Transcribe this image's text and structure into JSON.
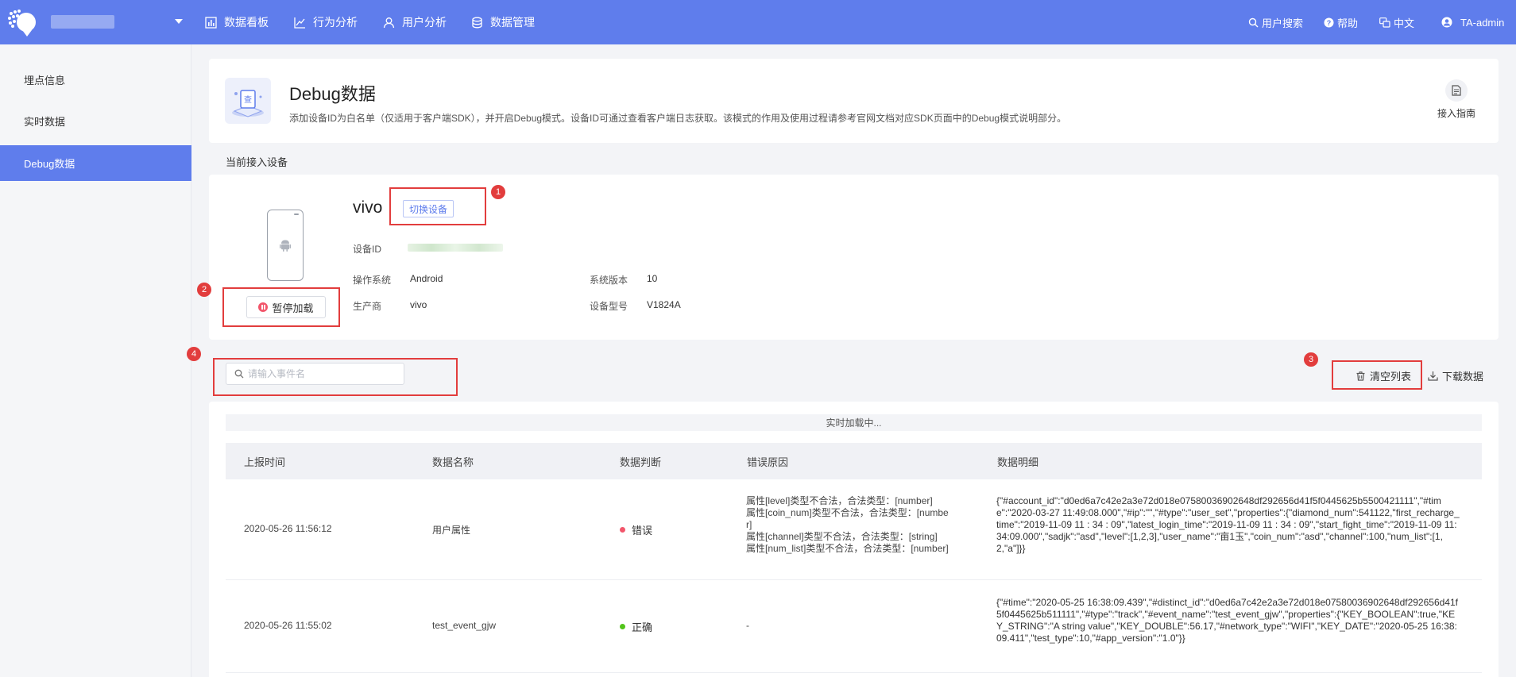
{
  "topbar": {
    "nav": [
      {
        "label": "数据看板",
        "icon": "bar-chart-icon"
      },
      {
        "label": "行为分析",
        "icon": "trend-line-icon"
      },
      {
        "label": "用户分析",
        "icon": "user-icon"
      },
      {
        "label": "数据管理",
        "icon": "database-icon"
      }
    ],
    "user_search": "用户搜索",
    "help": "帮助",
    "language": "中文",
    "account": "TA-admin"
  },
  "sidebar": {
    "items": [
      {
        "label": "埋点信息"
      },
      {
        "label": "实时数据"
      },
      {
        "label": "Debug数据",
        "active": true
      }
    ]
  },
  "header": {
    "title": "Debug数据",
    "description": "添加设备ID为白名单（仅适用于客户端SDK），并开启Debug模式。设备ID可通过查看客户端日志获取。该模式的作用及使用过程请参考官网文档对应SDK页面中的Debug模式说明部分。",
    "guide_label": "接入指南"
  },
  "device": {
    "section_label": "当前接入设备",
    "name": "vivo",
    "switch_label": "切换设备",
    "pause_label": "暂停加载",
    "id_label": "设备ID",
    "os_label": "操作系统",
    "os_value": "Android",
    "version_label": "系统版本",
    "version_value": "10",
    "maker_label": "生产商",
    "maker_value": "vivo",
    "model_label": "设备型号",
    "model_value": "V1824A"
  },
  "toolbar": {
    "search_placeholder": "请输入事件名",
    "clear_label": "清空列表",
    "download_label": "下载数据"
  },
  "annotations": [
    "1",
    "2",
    "3",
    "4"
  ],
  "table": {
    "loading_text": "实时加载中...",
    "columns": [
      "上报时间",
      "数据名称",
      "数据判断",
      "错误原因",
      "数据明细"
    ],
    "rows": [
      {
        "time": "2020-05-26 11:56:12",
        "name": "用户属性",
        "status": "错误",
        "status_color": "#f2566b",
        "error_lines": [
          "属性[level]类型不合法，合法类型：[number]",
          "属性[coin_num]类型不合法，合法类型：[numbe",
          "r]",
          "属性[channel]类型不合法，合法类型：[string]",
          "属性[num_list]类型不合法，合法类型：[number]"
        ],
        "detail": "{\"#account_id\":\"d0ed6a7c42e2a3e72d018e07580036902648df292656d41f5f0445625b5500421111\",\"#time\":\"2020-03-27 11:49:08.000\",\"#ip\":\"\",\"#type\":\"user_set\",\"properties\":{\"diamond_num\":541122,\"first_recharge_time\":\"2019-11-09 11 : 34 : 09\",\"latest_login_time\":\"2019-11-09 11 : 34 : 09\",\"start_fight_time\":\"2019-11-09 11:34:09.000\",\"sadjk\":\"asd\",\"level\":[1,2,3],\"user_name\":\"亩1玉\",\"coin_num\":\"asd\",\"channel\":100,\"num_list\":[1,2,\"a\"]}}"
      },
      {
        "time": "2020-05-26 11:55:02",
        "name": "test_event_gjw",
        "status": "正确",
        "status_color": "#52c41a",
        "error_lines": [
          "-"
        ],
        "detail": "{\"#time\":\"2020-05-25 16:38:09.439\",\"#distinct_id\":\"d0ed6a7c42e2a3e72d018e07580036902648df292656d41f5f0445625b511111\",\"#type\":\"track\",\"#event_name\":\"test_event_gjw\",\"properties\":{\"KEY_BOOLEAN\":true,\"KEY_STRING\":\"A string value\",\"KEY_DOUBLE\":56.17,\"#network_type\":\"WIFI\",\"KEY_DATE\":\"2020-05-25 16:38:09.411\",\"test_type\":10,\"#app_version\":\"1.0\"}}"
      }
    ]
  }
}
